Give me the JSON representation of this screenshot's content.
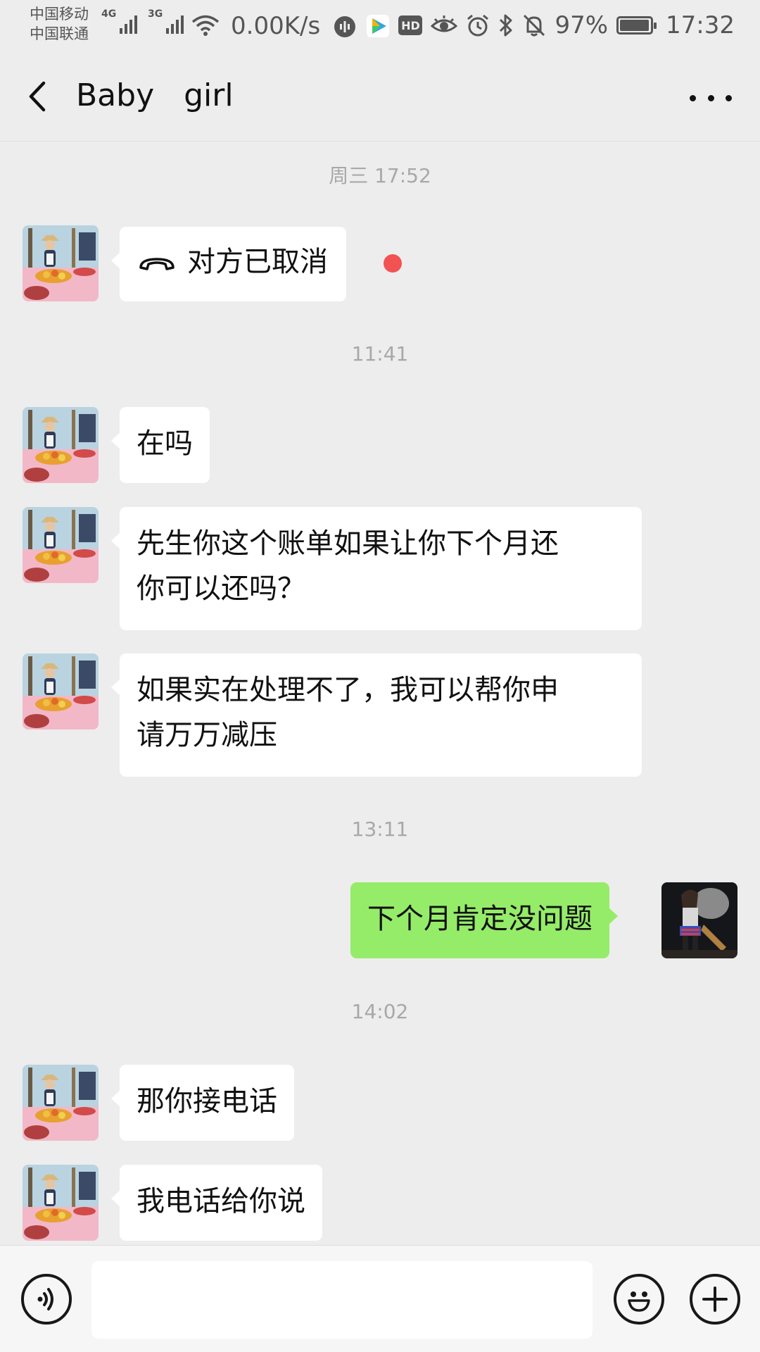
{
  "status_bar": {
    "carrier_1": "中国移动",
    "carrier_2": "中国联通",
    "network_1": "4G",
    "network_2": "3G",
    "speed": "0.00K/s",
    "hd_label": "HD",
    "battery_percent": "97%",
    "battery_level": 0.97,
    "time": "17:32",
    "icons": [
      "signal-icon",
      "wifi-icon",
      "audio-app-icon",
      "video-app-icon",
      "hd-icon",
      "eye-icon",
      "alarm-icon",
      "bluetooth-icon",
      "mute-icon",
      "battery-icon"
    ]
  },
  "header": {
    "title": "Baby   girl",
    "back_icon": "chevron-left-icon",
    "more_icon": "more-dots-icon"
  },
  "messages": [
    {
      "type": "timestamp",
      "text": "周三 17:52"
    },
    {
      "type": "call",
      "from": "them",
      "text": "对方已取消",
      "unread": true,
      "icon": "hangup-phone-icon"
    },
    {
      "type": "timestamp",
      "text": "11:41"
    },
    {
      "type": "text",
      "from": "them",
      "text": "在吗"
    },
    {
      "type": "text",
      "from": "them",
      "lines": [
        "先生你这个账单如果让你下个月还",
        "你可以还吗？"
      ]
    },
    {
      "type": "text",
      "from": "them",
      "lines": [
        "如果实在处理不了，我可以帮你申",
        "请万万减压"
      ]
    },
    {
      "type": "timestamp",
      "text": "13:11"
    },
    {
      "type": "text",
      "from": "me",
      "text": "下个月肯定没问题"
    },
    {
      "type": "timestamp",
      "text": "14:02"
    },
    {
      "type": "text",
      "from": "them",
      "text": "那你接电话"
    },
    {
      "type": "text",
      "from": "them",
      "text": "我电话给你说"
    }
  ],
  "input_bar": {
    "voice_icon": "voice-icon",
    "emoji_icon": "emoji-icon",
    "plus_icon": "plus-icon",
    "placeholder": ""
  },
  "colors": {
    "background": "#ededed",
    "outgoing_bubble": "#95ec69",
    "incoming_bubble": "#ffffff",
    "unread_dot": "#f25252",
    "timestamp": "#a8a8a8"
  }
}
